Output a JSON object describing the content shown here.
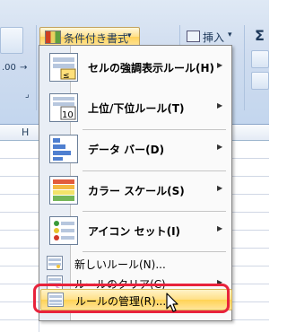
{
  "ribbon": {
    "conditional_formatting_label": "条件付き書式",
    "insert_label": "挿入",
    "sigma_glyph": "Σ",
    "format_fragment": ".00",
    "column_letter": "H"
  },
  "menu": {
    "items_large": [
      {
        "label": "セルの強調表示ルール(H)",
        "icon": "highlight-cells-icon"
      },
      {
        "label": "上位/下位ルール(T)",
        "icon": "top-bottom-icon",
        "icon_number": "10"
      },
      {
        "label": "データ バー(D)",
        "icon": "data-bars-icon"
      },
      {
        "label": "カラー スケール(S)",
        "icon": "color-scale-icon"
      },
      {
        "label": "アイコン セット(I)",
        "icon": "icon-sets-icon"
      }
    ],
    "items_small": [
      {
        "label": "新しいルール(N)...",
        "icon": "new-rule-icon"
      },
      {
        "label": "ルールのクリア(C)",
        "icon": "clear-rules-icon"
      },
      {
        "label": "ルールの管理(R)...",
        "icon": "manage-rules-icon"
      }
    ]
  },
  "colors": {
    "highlight_box": "#e8233b",
    "hover_item": "#ffd355"
  }
}
